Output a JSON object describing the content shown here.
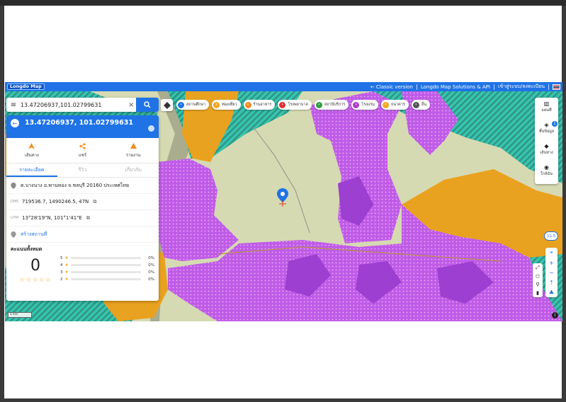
{
  "topbar": {
    "logo": "Longdo Map",
    "links": [
      "← Classic version",
      "Longdo Map Solutions & API",
      "เข้าสู่ระบบ/ลงทะเบียน"
    ]
  },
  "search": {
    "value": "13.47206937,101.02799631"
  },
  "chips": [
    {
      "label": "สถานศึกษา",
      "color": "#1f73e6",
      "icon": "school-icon"
    },
    {
      "label": "ท่องเที่ยว",
      "color": "#f5a623",
      "icon": "travel-icon"
    },
    {
      "label": "ร้านอาหาร",
      "color": "#f08a24",
      "icon": "restaurant-icon"
    },
    {
      "label": "โรงพยาบาล",
      "color": "#e03131",
      "icon": "hospital-icon"
    },
    {
      "label": "สถานีบริการ",
      "color": "#2f9e44",
      "icon": "gas-station-icon"
    },
    {
      "label": "โรงแรม",
      "color": "#ae3ec9",
      "icon": "hotel-icon"
    },
    {
      "label": "ธนาคาร",
      "color": "#f5a623",
      "icon": "bank-icon"
    },
    {
      "label": "อื่น",
      "color": "#555555",
      "icon": "more-icon"
    }
  ],
  "panel": {
    "title": "13.47206937, 101.02799631",
    "actions": [
      "เส้นทาง",
      "แชร์",
      "รายงาน"
    ],
    "tabs": [
      "รายละเอียด",
      "รีวิว",
      "เกี่ยวกับ"
    ],
    "address": "ต.บางนาง อ.พานทอง จ.ชลบุรี 20160 ประเทศไทย",
    "dms_label": "DMS",
    "dms": "719536.7, 1490246.5, 47N",
    "utm_label": "UTM",
    "utm": "13°28'19\"N, 101°1'41\"E",
    "create_place": "สร้างสถานที่",
    "ratings_title": "คะแนนทั้งหมด",
    "score": "0",
    "stars": "☆☆☆☆☆",
    "bars": [
      {
        "star": "5",
        "pct": "0%"
      },
      {
        "star": "4",
        "pct": "0%"
      },
      {
        "star": "3",
        "pct": "0%"
      },
      {
        "star": "2",
        "pct": "0%"
      }
    ]
  },
  "right_controls": {
    "items": [
      "แผนที่",
      "ชั้นข้อมูล",
      "เส้นทาง",
      "ใกล้ฉัน"
    ],
    "badge": "1",
    "zoom": "12.5"
  },
  "scale": "1 km",
  "colors": {
    "accent": "#1f73e6",
    "zone_purple": "#b84be6",
    "zone_orange": "#e9a21f",
    "zone_teal": "#1fbfa8",
    "land": "#d6dab2"
  }
}
